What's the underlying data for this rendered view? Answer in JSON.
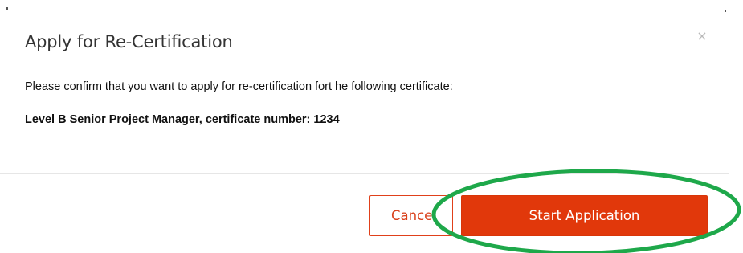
{
  "dialog": {
    "title": "Apply for Re-Certification",
    "close_symbol": "×",
    "message": "Please confirm that you want to apply for re-certification fort he following certificate:",
    "certificate_line": "Level B Senior Project Manager, certificate number: 1234"
  },
  "buttons": {
    "cancel_label": "Cancel",
    "start_label": "Start Application"
  },
  "colors": {
    "primary": "#e1380b",
    "annotation": "#1ea84a"
  },
  "icons": {
    "close": "close-icon"
  }
}
